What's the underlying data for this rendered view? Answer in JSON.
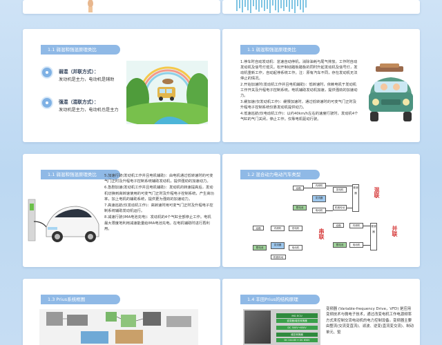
{
  "slides": {
    "s3": {
      "title": "1.1 弱混和强混原理类比",
      "weak_label": "弱混（并联方式）：",
      "weak_desc": "发动机是主力，电动机是辅助",
      "strong_label": "强混（混联方式）：",
      "strong_desc": "发动机是主力，电动机也是主力"
    },
    "s4": {
      "title": "1.1 弱混和强混原理类比",
      "steps": [
        "1.停车时自动发动机：怠速自动停机，消除油耗与尾气排放。工作时自动发动机及信号灯熄灭。松开制动踏板踏板的同时升起发动机及信号灯，发动机重新工作，自动起停系统工作。注：原有汽车不同，存在发动机无法停止的情况。",
        "2.开始加速时(发动机工作并且电机辅助)：低转速时，依赖电机于发动机工作开关及升程电子控制系统。电机辅助发动机加速，提供强劲的加速动力。",
        "3.缓加速(仅发动机工作)：缓慢加速时，通过低转速时的可变气门正时及升程电子控制系统仅靠发动机提供动力。",
        "4.低速巡航(仅电动机工作)：以约40km/h左右的速度行驶时，发动机4个气缸的气门关闭，停止工作。仅靠电机驱动行驶。"
      ]
    },
    "s5": {
      "title": "1.1 弱混和强混原理类比",
      "steps": [
        "5.加速行驶(发动机工作并且电机辅助)：由电机通过低转速时的可变气门正时及升程电子控制系统辅助发动机，提供强劲的加速动力。",
        "6.急剧加速(发动机工作并且电机辅助)：发动机的转速提高后，发动机切换到高转速使用的可变气门正时及升程电子控制系统，产生高功率，加上电机的辅助系统，提供更为强劲的加速动力。",
        "7.高速巡航(仅发动机工作)：高转速时用可变气门正时及升程电子控制系统辅助发动机运行。",
        "8.减速行驶(IMA电池充电)：发动机的4个气缸全部停止工作。电机最大限度地利用减速能量给IMA电池充电。在电机辅助时进行再利用。"
      ]
    },
    "s6": {
      "title": "1.2 混合动力电动汽车类型",
      "serial_label": "混联",
      "series_label": "串联",
      "parallel_label": "并联",
      "blocks": {
        "engine": "内燃机",
        "fuel": "油箱",
        "motor": "电动机",
        "generator": "发电机",
        "battery": "蓄电池",
        "converter": "变流器",
        "trans": "机械传动",
        "diff": "差速器"
      }
    },
    "s7": {
      "title": "1.3 Prius系统框图"
    },
    "s8": {
      "title": "1.4 丰田Prius的结构原理",
      "text": "变频器 (Variable-frequency Drive，VFD) 是应用变频技术与微电子技术，通过改变电机工作电源频率方式来控制交流电动机的电力控制设备。变频器主要由整流(交流变直流)、滤波、逆变(直流变交流)、制动单元、驱",
      "panel_header": "MG ECU",
      "panel_sub": "逆变器/增压转换器",
      "panel_dc": "DC 500V→650V",
      "panel_dc2": "DC 244.8V ↔ DC 650V",
      "panel_conv": "增压转换器"
    }
  }
}
